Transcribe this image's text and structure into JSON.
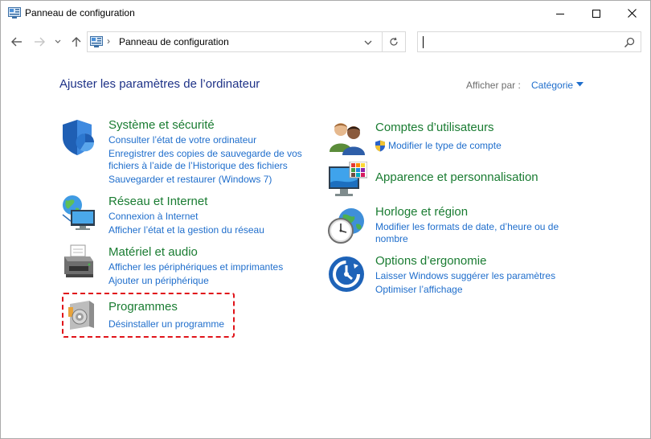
{
  "window": {
    "title": "Panneau de configuration"
  },
  "address": {
    "path": "Panneau de configuration",
    "separator": "›"
  },
  "search": {
    "placeholder": ""
  },
  "main": {
    "heading": "Ajuster les paramètres de l’ordinateur",
    "view_by_label": "Afficher par :",
    "view_by_value": "Catégorie"
  },
  "categories_left": [
    {
      "title": "Système et sécurité",
      "icon": "shield-icon",
      "links": [
        "Consulter l’état de votre ordinateur",
        "Enregistrer des copies de sauvegarde de vos",
        "fichiers à l’aide de l’Historique des fichiers",
        "Sauvegarder et restaurer (Windows 7)"
      ]
    },
    {
      "title": "Réseau et Internet",
      "icon": "network-globe-icon",
      "links": [
        "Connexion à Internet",
        "Afficher l’état et la gestion du réseau"
      ]
    },
    {
      "title": "Matériel et audio",
      "icon": "printer-icon",
      "links": [
        "Afficher les périphériques et imprimantes",
        "Ajouter un périphérique"
      ]
    },
    {
      "title": "Programmes",
      "icon": "programs-disc-icon",
      "links": [
        "Désinstaller un programme"
      ]
    }
  ],
  "categories_right": [
    {
      "title": "Comptes d’utilisateurs",
      "icon": "users-icon",
      "links": [
        "Modifier le type de compte"
      ]
    },
    {
      "title": "Apparence et personnalisation",
      "icon": "monitor-palette-icon",
      "links": []
    },
    {
      "title": "Horloge et région",
      "icon": "clock-globe-icon",
      "links": [
        "Modifier les formats de date, d’heure ou de",
        "nombre"
      ]
    },
    {
      "title": "Options d’ergonomie",
      "icon": "ease-of-access-icon",
      "links": [
        "Laisser Windows suggérer les paramètres",
        "Optimiser l’affichage"
      ]
    }
  ],
  "colors": {
    "link": "#1f6ecc",
    "category_title": "#1a7c32",
    "heading": "#1e3287",
    "highlight": "#e0141a"
  }
}
